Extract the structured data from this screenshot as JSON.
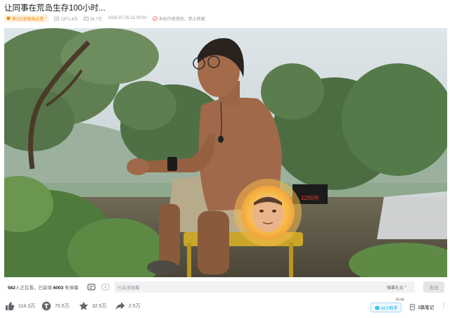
{
  "video": {
    "title": "让同事在荒岛生存100小时...",
    "ranking_badge": "第3日周每周必看",
    "views": "1371.4万",
    "danmaku_count": "16.7万",
    "publish_time": "2025-07-25 11:00:00",
    "copyright_note": "未经作者授权，禁止转载"
  },
  "player": {
    "scene_sign_text": "1200元"
  },
  "danmaku": {
    "viewers_prefix": "562",
    "viewers_text": "人正在看，已装填",
    "loaded_count": "6003",
    "loaded_suffix": "条弹幕",
    "input_placeholder": "已关闭弹幕",
    "etiquette_label": "弹幕礼仪",
    "send_label": "发送"
  },
  "actions": {
    "like_count": "114.3万",
    "coin_count": "70.5万",
    "favorite_count": "32.5万",
    "share_count": "2.5万",
    "ai_assistant_label": "AI小助手",
    "ai_tag": "新功能",
    "notes_label": "3篇笔记"
  },
  "colors": {
    "accent": "#00aeec",
    "badge_orange": "#f38a00",
    "icon_gray": "#61666d",
    "meta_gray": "#9499a0"
  },
  "icons": [
    "play-count-icon",
    "danmaku-count-icon",
    "no-reprint-icon",
    "danmaku-toggle-icon",
    "danmaku-settings-icon",
    "chevron-right-icon",
    "like-icon",
    "coin-icon",
    "favorite-icon",
    "share-icon",
    "ai-assistant-icon",
    "notes-icon",
    "more-icon"
  ]
}
